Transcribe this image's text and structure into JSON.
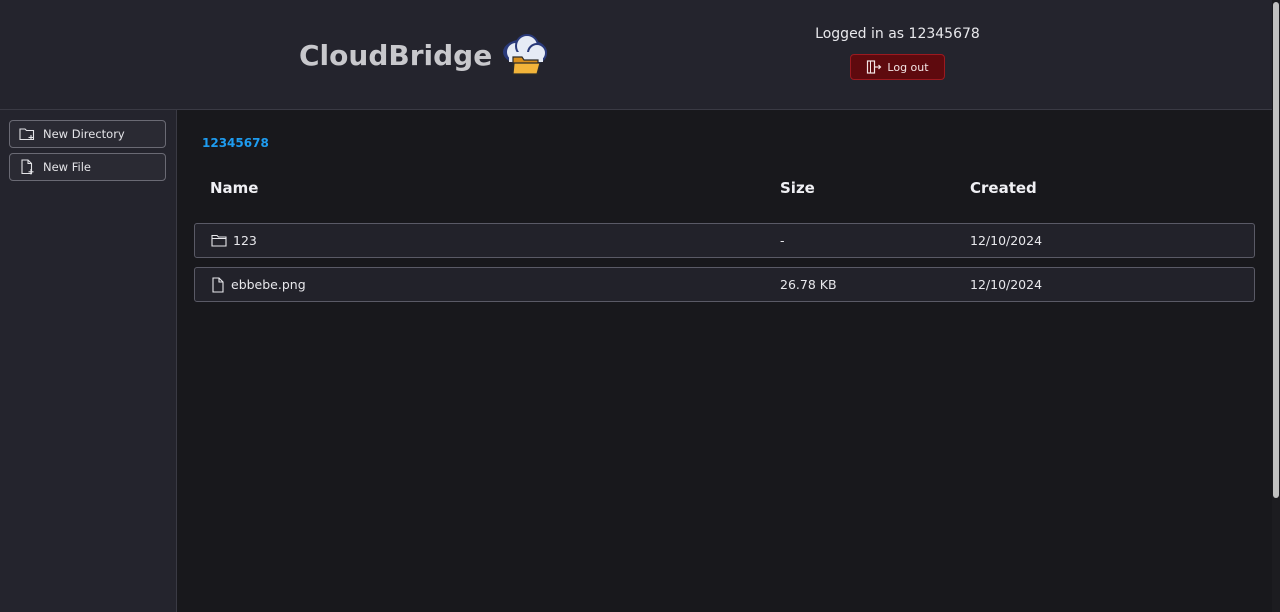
{
  "app": {
    "title": "CloudBridge"
  },
  "header": {
    "logged_in_text": "Logged in as 12345678",
    "logout_label": "Log out"
  },
  "sidebar": {
    "items": [
      {
        "label": "New Directory",
        "icon": "folder-plus-icon"
      },
      {
        "label": "New File",
        "icon": "file-plus-icon"
      }
    ]
  },
  "breadcrumb": {
    "current": "12345678"
  },
  "table": {
    "columns": [
      "Name",
      "Size",
      "Created"
    ],
    "rows": [
      {
        "type": "folder",
        "icon": "folder-icon",
        "name": "123",
        "size": "-",
        "created": "12/10/2024"
      },
      {
        "type": "file",
        "icon": "file-icon",
        "name": "ebbebe.png",
        "size": "26.78 KB",
        "created": "12/10/2024"
      }
    ]
  },
  "colors": {
    "header_bg": "#24242d",
    "main_bg": "#18181c",
    "accent_link": "#1e9cf0",
    "logout_bg": "#5e0a0e"
  }
}
